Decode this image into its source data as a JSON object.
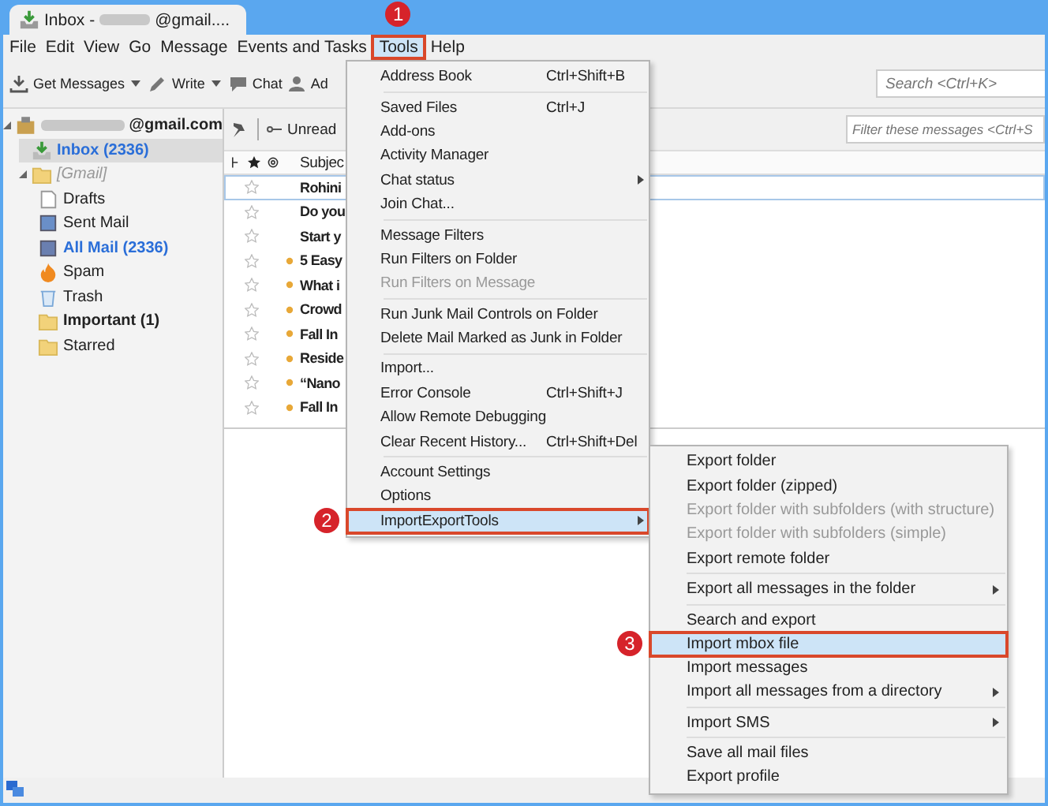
{
  "window": {
    "tab_title": "Inbox -",
    "tab_title_suffix": "@gmail...."
  },
  "menubar": [
    {
      "label": "File",
      "selected": false
    },
    {
      "label": "Edit",
      "selected": false
    },
    {
      "label": "View",
      "selected": false
    },
    {
      "label": "Go",
      "selected": false
    },
    {
      "label": "Message",
      "selected": false
    },
    {
      "label": "Events and Tasks",
      "selected": false
    },
    {
      "label": "Tools",
      "selected": true,
      "callout": "1"
    },
    {
      "label": "Help",
      "selected": false
    }
  ],
  "toolbar": {
    "buttons": [
      {
        "label": "Get Messages",
        "kind": "get",
        "dropdown": true
      },
      {
        "label": "Write",
        "kind": "write",
        "dropdown": true
      },
      {
        "label": "Chat",
        "kind": "chat"
      },
      {
        "label": "Ad",
        "kind": "contacts"
      }
    ],
    "search": {
      "placeholder": "Search <Ctrl+K>"
    }
  },
  "folders": [
    {
      "label": "@gmail.com",
      "kind": "account",
      "expanded": true,
      "children": [
        {
          "label": "Inbox (2336)",
          "kind": "inbox",
          "selected": true,
          "unread": true
        },
        {
          "label": "[Gmail]",
          "kind": "group",
          "expanded": true,
          "children": [
            {
              "label": "Drafts",
              "kind": "drafts",
              "selected": false,
              "unread": false
            },
            {
              "label": "Sent Mail",
              "kind": "sent",
              "selected": false,
              "unread": false
            },
            {
              "label": "All Mail (2336)",
              "kind": "archive",
              "selected": false,
              "unread": true
            },
            {
              "label": "Spam",
              "kind": "spam",
              "selected": false,
              "unread": false
            },
            {
              "label": "Trash",
              "kind": "trash",
              "selected": false,
              "unread": false
            },
            {
              "label": "Important (1)",
              "kind": "folder",
              "selected": false,
              "unread": true
            },
            {
              "label": "Starred",
              "kind": "folder",
              "selected": false,
              "unread": false
            }
          ]
        }
      ]
    }
  ],
  "message_list": {
    "toolbar": {
      "unread_label": "Unread",
      "filter_placeholder": "Filter these messages <Ctrl+S"
    },
    "columns": [
      "Subjec"
    ],
    "rows": [
      {
        "subject": "Rohini",
        "selected": true,
        "starred": false,
        "new": false
      },
      {
        "subject": "Do you",
        "selected": false,
        "starred": false,
        "new": false
      },
      {
        "subject": "Start y",
        "selected": false,
        "starred": false,
        "new": false
      },
      {
        "subject": "5 Easy",
        "selected": false,
        "starred": false,
        "new": true
      },
      {
        "subject": "What i",
        "selected": false,
        "starred": false,
        "new": true
      },
      {
        "subject": "Crowd",
        "selected": false,
        "starred": false,
        "new": true
      },
      {
        "subject": "Fall In",
        "selected": false,
        "starred": false,
        "new": true
      },
      {
        "subject": "Reside",
        "selected": false,
        "starred": false,
        "new": true
      },
      {
        "subject": "“Nano",
        "selected": false,
        "starred": false,
        "new": true
      },
      {
        "subject": "Fall In",
        "selected": false,
        "starred": false,
        "new": true
      }
    ]
  },
  "tools_menu": [
    {
      "kind": "item",
      "label": "Address Book",
      "shortcut": "Ctrl+Shift+B",
      "disabled": false,
      "selected": false,
      "submenu": false
    },
    {
      "kind": "separator"
    },
    {
      "kind": "item",
      "label": "Saved Files",
      "shortcut": "Ctrl+J",
      "disabled": false,
      "selected": false,
      "submenu": false
    },
    {
      "kind": "item",
      "label": "Add-ons",
      "disabled": false,
      "selected": false,
      "submenu": false
    },
    {
      "kind": "item",
      "label": "Activity Manager",
      "disabled": false,
      "selected": false,
      "submenu": false
    },
    {
      "kind": "item",
      "label": "Chat status",
      "disabled": false,
      "selected": false,
      "submenu": true
    },
    {
      "kind": "item",
      "label": "Join Chat...",
      "disabled": false,
      "selected": false,
      "submenu": false
    },
    {
      "kind": "separator"
    },
    {
      "kind": "item",
      "label": "Message Filters",
      "disabled": false,
      "selected": false,
      "submenu": false
    },
    {
      "kind": "item",
      "label": "Run Filters on Folder",
      "disabled": false,
      "selected": false,
      "submenu": false
    },
    {
      "kind": "item",
      "label": "Run Filters on Message",
      "disabled": true,
      "selected": false,
      "submenu": false
    },
    {
      "kind": "separator"
    },
    {
      "kind": "item",
      "label": "Run Junk Mail Controls on Folder",
      "disabled": false,
      "selected": false,
      "submenu": false
    },
    {
      "kind": "item",
      "label": "Delete Mail Marked as Junk in Folder",
      "disabled": false,
      "selected": false,
      "submenu": false
    },
    {
      "kind": "separator"
    },
    {
      "kind": "item",
      "label": "Import...",
      "disabled": false,
      "selected": false,
      "submenu": false
    },
    {
      "kind": "item",
      "label": "Error Console",
      "shortcut": "Ctrl+Shift+J",
      "disabled": false,
      "selected": false,
      "submenu": false
    },
    {
      "kind": "item",
      "label": "Allow Remote Debugging",
      "disabled": false,
      "selected": false,
      "submenu": false
    },
    {
      "kind": "item",
      "label": "Clear Recent History...",
      "shortcut": "Ctrl+Shift+Del",
      "disabled": false,
      "selected": false,
      "submenu": false
    },
    {
      "kind": "separator"
    },
    {
      "kind": "item",
      "label": "Account Settings",
      "disabled": false,
      "selected": false,
      "submenu": false
    },
    {
      "kind": "item",
      "label": "Options",
      "disabled": false,
      "selected": false,
      "submenu": false
    },
    {
      "kind": "item",
      "label": "ImportExportTools",
      "disabled": false,
      "selected": true,
      "submenu": true,
      "callout": "2"
    }
  ],
  "importexport_menu": [
    {
      "kind": "item",
      "label": "Export folder",
      "disabled": false,
      "selected": false,
      "submenu": false
    },
    {
      "kind": "item",
      "label": "Export folder (zipped)",
      "disabled": false,
      "selected": false,
      "submenu": false
    },
    {
      "kind": "item",
      "label": "Export folder with subfolders (with structure)",
      "disabled": true,
      "selected": false,
      "submenu": false
    },
    {
      "kind": "item",
      "label": "Export folder with subfolders (simple)",
      "disabled": true,
      "selected": false,
      "submenu": false
    },
    {
      "kind": "item",
      "label": "Export remote folder",
      "disabled": false,
      "selected": false,
      "submenu": false
    },
    {
      "kind": "separator"
    },
    {
      "kind": "item",
      "label": "Export all messages in the folder",
      "disabled": false,
      "selected": false,
      "submenu": true
    },
    {
      "kind": "separator"
    },
    {
      "kind": "item",
      "label": "Search and export",
      "disabled": false,
      "selected": false,
      "submenu": false
    },
    {
      "kind": "item",
      "label": "Import mbox file",
      "disabled": false,
      "selected": true,
      "submenu": false,
      "callout": "3"
    },
    {
      "kind": "item",
      "label": "Import messages",
      "disabled": false,
      "selected": false,
      "submenu": false
    },
    {
      "kind": "item",
      "label": "Import all messages from a directory",
      "disabled": false,
      "selected": false,
      "submenu": true
    },
    {
      "kind": "separator"
    },
    {
      "kind": "item",
      "label": "Import SMS",
      "disabled": false,
      "selected": false,
      "submenu": true
    },
    {
      "kind": "separator"
    },
    {
      "kind": "item",
      "label": "Save all mail files",
      "disabled": false,
      "selected": false,
      "submenu": false
    },
    {
      "kind": "item",
      "label": "Export profile",
      "disabled": false,
      "selected": false,
      "submenu": false
    }
  ]
}
